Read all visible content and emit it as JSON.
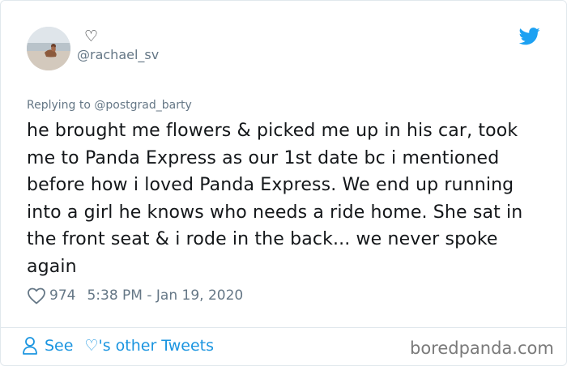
{
  "author": {
    "display_name": "♡",
    "handle": "@rachael_sv"
  },
  "icons": {
    "avatar": "profile-photo-beach",
    "brand": "twitter-bird-icon",
    "like": "heart-outline-icon",
    "person": "person-icon"
  },
  "colors": {
    "twitter_blue": "#1da1f2",
    "link_blue": "#1b95e0",
    "muted_text": "#657786",
    "body_text": "#14171a",
    "divider": "#e1e8ed"
  },
  "reply": {
    "prefix": "Replying to",
    "mention": "@postgrad_barty"
  },
  "tweet": {
    "text": "he brought me flowers & picked me up in his car, took me to Panda Express as our 1st date bc i mentioned before how i loved Panda Express. We end up running into a girl he knows who needs a ride home. She sat in the front seat & i rode in the back... we never spoke again",
    "likes": "974",
    "timestamp": "5:38 PM - Jan 19, 2020"
  },
  "footer": {
    "see_label": "See",
    "other_tweets_label": "♡'s other Tweets"
  },
  "watermark": "boredpanda.com"
}
